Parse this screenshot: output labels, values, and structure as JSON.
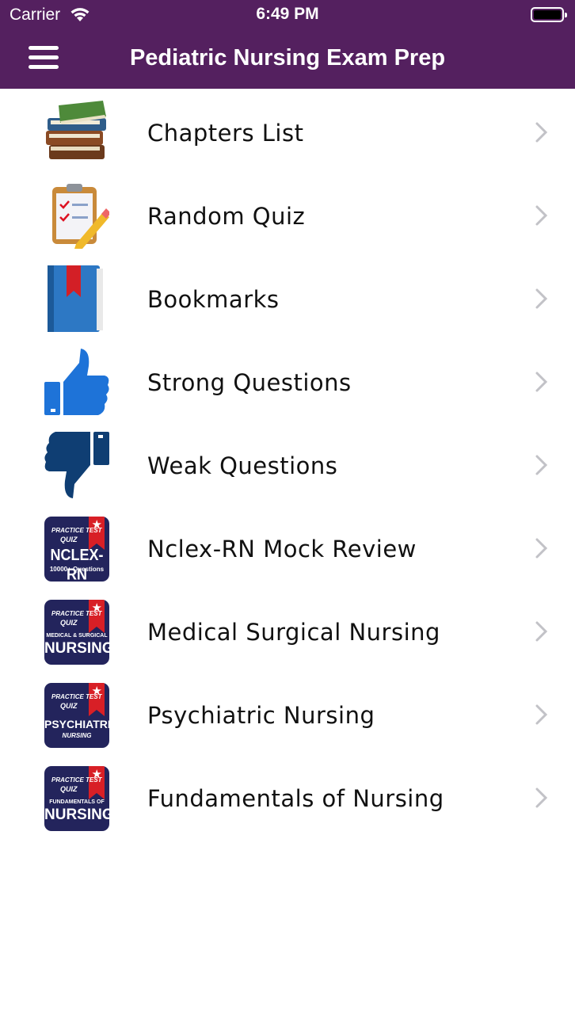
{
  "status_bar": {
    "carrier": "Carrier",
    "time": "6:49 PM"
  },
  "nav": {
    "title": "Pediatric Nursing Exam Prep",
    "menu_icon": "hamburger-menu-icon"
  },
  "colors": {
    "nav_background": "#54205f",
    "badge_background": "#23245c",
    "badge_ribbon": "#d81f26",
    "thumb_up": "#1e73d8",
    "thumb_down": "#0f3e73"
  },
  "menu": {
    "items": [
      {
        "label": "Chapters List",
        "icon": "books-icon"
      },
      {
        "label": "Random Quiz",
        "icon": "clipboard-pencil-icon"
      },
      {
        "label": "Bookmarks",
        "icon": "bookmark-book-icon"
      },
      {
        "label": "Strong Questions",
        "icon": "thumbs-up-icon"
      },
      {
        "label": "Weak Questions",
        "icon": "thumbs-down-icon"
      },
      {
        "label": "Nclex-RN Mock Review",
        "icon": "nclex-rn-badge-icon",
        "badge": {
          "line1": "PRACTICE TEST",
          "line2": "QUIZ",
          "line3": "NCLEX-RN",
          "line4": "10000+ Questions"
        }
      },
      {
        "label": "Medical Surgical Nursing",
        "icon": "medical-surgical-badge-icon",
        "badge": {
          "line1": "PRACTICE TEST",
          "line2": "QUIZ",
          "line3": "MEDICAL & SURGICAL",
          "line4": "NURSING"
        }
      },
      {
        "label": "Psychiatric Nursing",
        "icon": "psychiatric-badge-icon",
        "badge": {
          "line1": "PRACTICE TEST",
          "line2": "QUIZ",
          "line3": "PSYCHIATRIC",
          "line4": "NURSING"
        }
      },
      {
        "label": "Fundamentals of Nursing",
        "icon": "fundamentals-badge-icon",
        "badge": {
          "line1": "PRACTICE TEST",
          "line2": "QUIZ",
          "line3": "FUNDAMENTALS OF",
          "line4": "NURSING"
        }
      }
    ]
  }
}
